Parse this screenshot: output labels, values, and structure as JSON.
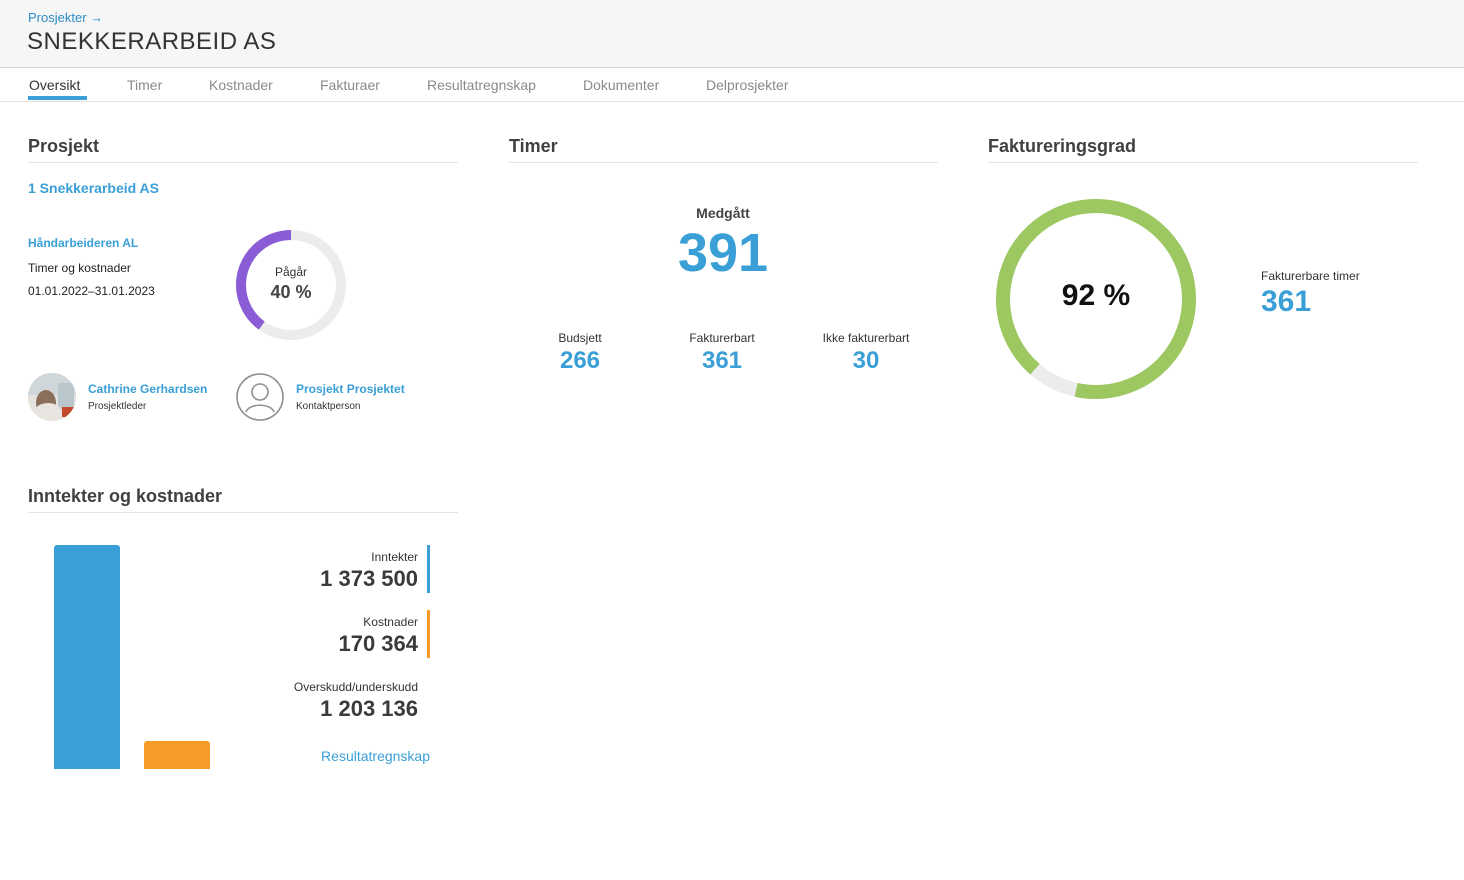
{
  "header": {
    "breadcrumb": "Prosjekter →",
    "title": "SNEKKERARBEID AS"
  },
  "tabs": [
    {
      "label": "Oversikt",
      "active": true
    },
    {
      "label": "Timer"
    },
    {
      "label": "Kostnader"
    },
    {
      "label": "Fakturaer"
    },
    {
      "label": "Resultatregnskap"
    },
    {
      "label": "Dokumenter"
    },
    {
      "label": "Delprosjekter"
    }
  ],
  "project": {
    "section_title": "Prosjekt",
    "name": "1 Snekkerarbeid AS",
    "customer": "Håndarbeideren AL",
    "type": "Timer og kostnader",
    "period": "01.01.2022–31.01.2023",
    "status_label": "Pågår",
    "progress_text": "40 %",
    "progress_fraction": 0.4,
    "progress_color": "#8a5cd6",
    "manager_name": "Cathrine Gerhardsen",
    "manager_role": "Prosjektleder",
    "contact_name": "Prosjekt Prosjektet",
    "contact_role": "Kontaktperson"
  },
  "timer": {
    "section_title": "Timer",
    "used_label": "Medgått",
    "used_value": "391",
    "budget_label": "Budsjett",
    "budget_value": "266",
    "billable_label": "Fakturerbart",
    "billable_value": "361",
    "nonbillable_label": "Ikke fakturerbart",
    "nonbillable_value": "30"
  },
  "billing": {
    "section_title": "Faktureringsgrad",
    "percent_text": "92 %",
    "fraction": 0.92,
    "ring_color": "#9dc760",
    "billable_hours_label": "Fakturerbare timer",
    "billable_hours_value": "361"
  },
  "finance": {
    "section_title": "Inntekter og kostnader",
    "income_label": "Inntekter",
    "income_value": "1 373 500",
    "income_amount": 1373500,
    "income_color": "#3a9fd6",
    "cost_label": "Kostnader",
    "cost_value": "170 364",
    "cost_amount": 170364,
    "cost_color": "#f89a28",
    "profit_label": "Overskudd/underskudd",
    "profit_value": "1 203 136",
    "report_link": "Resultatregnskap"
  }
}
